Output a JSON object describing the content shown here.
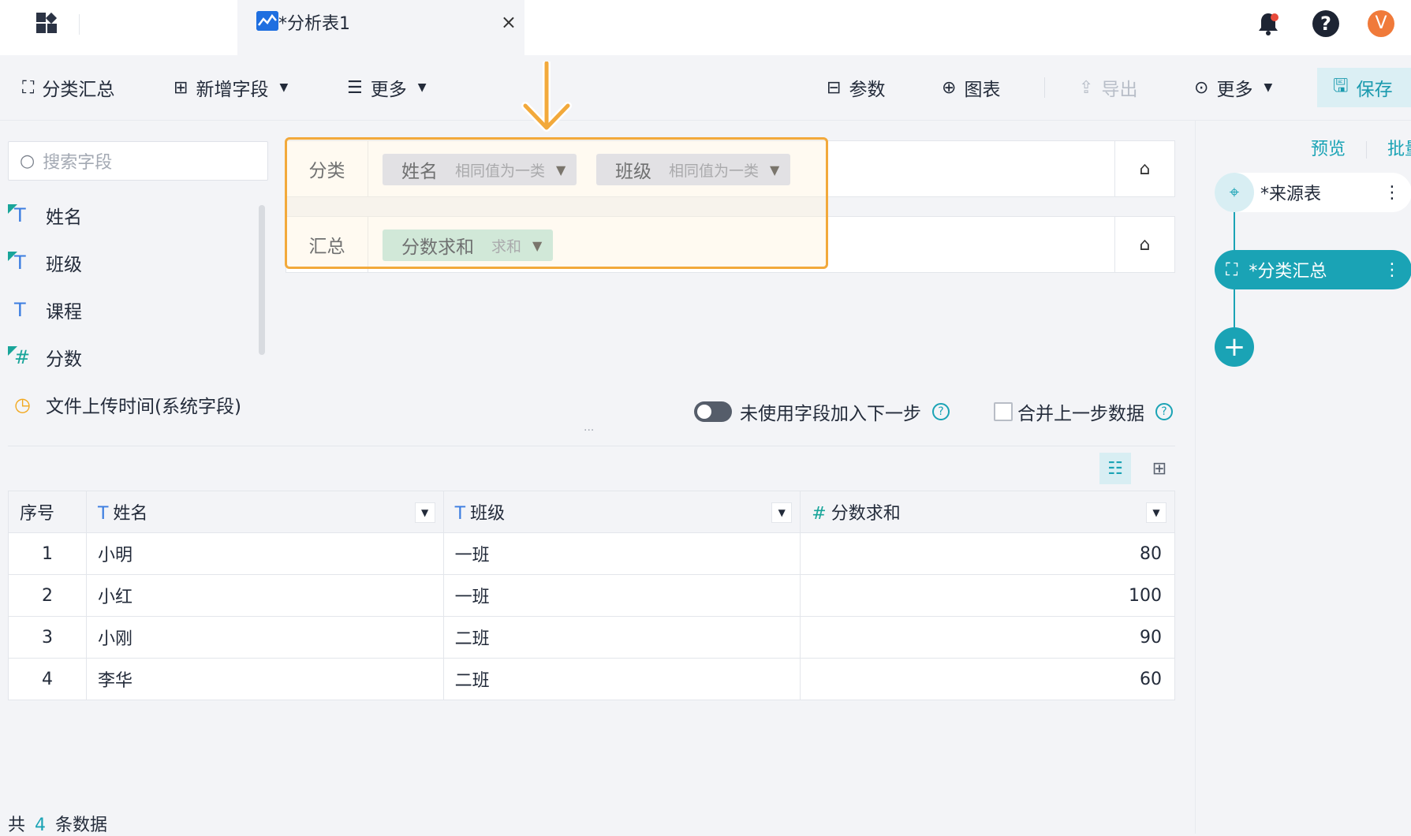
{
  "tab": {
    "title": "*分析表1",
    "close": "×"
  },
  "header": {
    "avatar_letter": "V",
    "help": "?"
  },
  "toolbar": {
    "group_summary": "分类汇总",
    "add_field": "新增字段",
    "more_left": "更多",
    "params": "参数",
    "chart": "图表",
    "export": "导出",
    "more_right": "更多",
    "save": "保存"
  },
  "left_panel": {
    "search_placeholder": "搜索字段",
    "fields": [
      {
        "name": "姓名",
        "type": "T"
      },
      {
        "name": "班级",
        "type": "T"
      },
      {
        "name": "课程",
        "type": "T"
      },
      {
        "name": "分数",
        "type": "#"
      },
      {
        "name": "文件上传时间(系统字段)",
        "type": "time"
      }
    ]
  },
  "rules": {
    "classify_label": "分类",
    "summary_label": "汇总",
    "classify_chips": [
      {
        "name": "姓名",
        "mode": "相同值为一类"
      },
      {
        "name": "班级",
        "mode": "相同值为一类"
      }
    ],
    "summary_chips": [
      {
        "name": "分数求和",
        "mode": "求和"
      }
    ]
  },
  "options": {
    "unused_fields": "未使用字段加入下一步",
    "merge_prev": "合并上一步数据",
    "help": "?"
  },
  "table": {
    "columns": [
      "序号",
      "姓名",
      "班级",
      "分数求和"
    ],
    "rows": [
      [
        "1",
        "小明",
        "一班",
        "80"
      ],
      [
        "2",
        "小红",
        "一班",
        "100"
      ],
      [
        "3",
        "小刚",
        "二班",
        "90"
      ],
      [
        "4",
        "李华",
        "二班",
        "60"
      ]
    ]
  },
  "footer": {
    "prefix": "共",
    "count": "4",
    "suffix": "条数据"
  },
  "right_panel": {
    "preview": "预览",
    "batch": "批量",
    "source_node": "*来源表",
    "current_node": "*分类汇总",
    "more": "⋮",
    "add": "+"
  },
  "colors": {
    "accent": "#1aa3b5",
    "highlight": "#f2a93b",
    "chip_class": "#d3d9ec",
    "chip_sum": "#b9e3d9"
  }
}
